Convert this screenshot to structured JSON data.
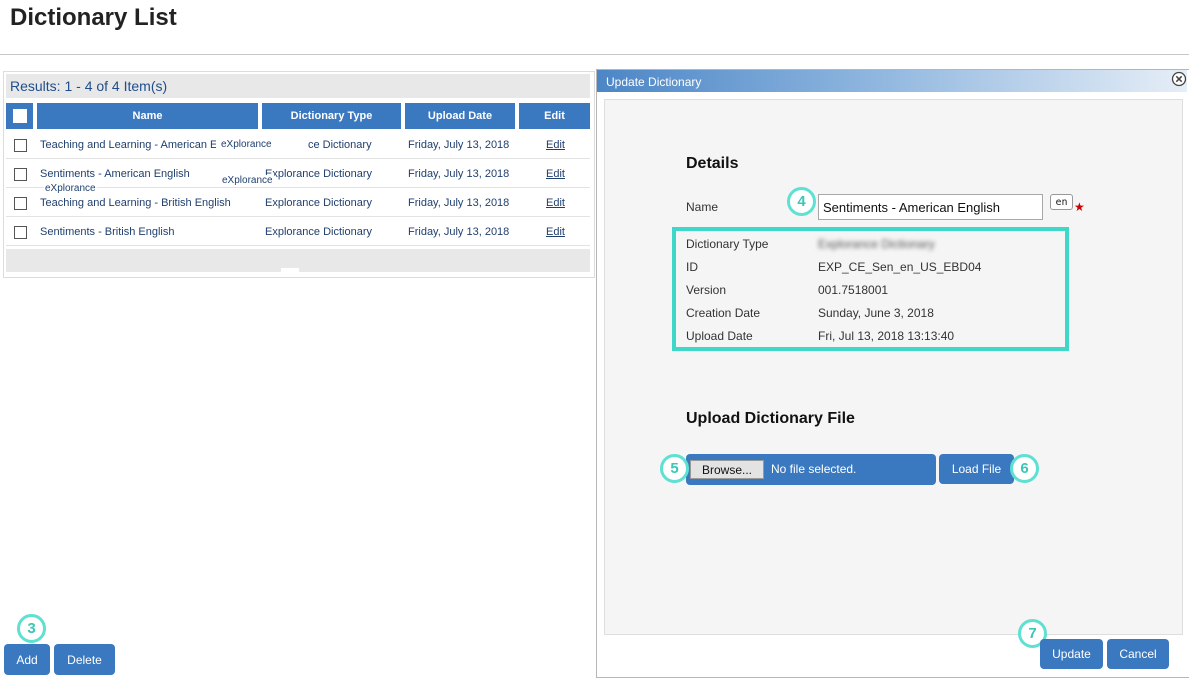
{
  "page": {
    "title": "Dictionary List"
  },
  "list": {
    "results": "Results: 1 - 4 of 4 Item(s)",
    "columns": {
      "name": "Name",
      "type": "Dictionary Type",
      "upload_date": "Upload Date",
      "edit": "Edit"
    },
    "rows": [
      {
        "name": "Teaching and Learning - American En",
        "type": "ce Dictionary",
        "upload_date": "Friday, July 13, 2018",
        "edit": "Edit"
      },
      {
        "name": "Sentiments - American English",
        "type": "Explorance Dictionary",
        "upload_date": "Friday, July 13, 2018",
        "edit": "Edit"
      },
      {
        "name": "Teaching and Learning - British English",
        "type": "Explorance Dictionary",
        "upload_date": "Friday, July 13, 2018",
        "edit": "Edit"
      },
      {
        "name": "Sentiments - British English",
        "type": "Explorance Dictionary",
        "upload_date": "Friday, July 13, 2018",
        "edit": "Edit"
      }
    ],
    "overlay_labels": [
      "eXplorance",
      "eXplorance",
      "eXplorance"
    ],
    "add_label": "Add",
    "delete_label": "Delete"
  },
  "dialog": {
    "title": "Update Dictionary",
    "details_heading": "Details",
    "name_label": "Name",
    "name_value": "Sentiments - American English",
    "lang_badge": "en",
    "required_mark": "★",
    "fields": [
      {
        "label": "Dictionary Type",
        "value": "Explorance Dictionary"
      },
      {
        "label": "ID",
        "value": "EXP_CE_Sen_en_US_EBD04"
      },
      {
        "label": "Version",
        "value": "001.7518001"
      },
      {
        "label": "Creation Date",
        "value": "Sunday, June 3, 2018"
      },
      {
        "label": "Upload Date",
        "value": "Fri, Jul 13, 2018 13:13:40"
      }
    ],
    "upload_heading": "Upload Dictionary File",
    "browse_label": "Browse...",
    "file_status": "No file selected.",
    "load_file_label": "Load File",
    "update_label": "Update",
    "cancel_label": "Cancel",
    "close_icon": "close-circle-icon"
  },
  "callouts": [
    "3",
    "4",
    "5",
    "6",
    "7"
  ],
  "colors": {
    "accent": "#3a78c0",
    "highlight": "#3fd8c8",
    "required": "#cc0000"
  }
}
